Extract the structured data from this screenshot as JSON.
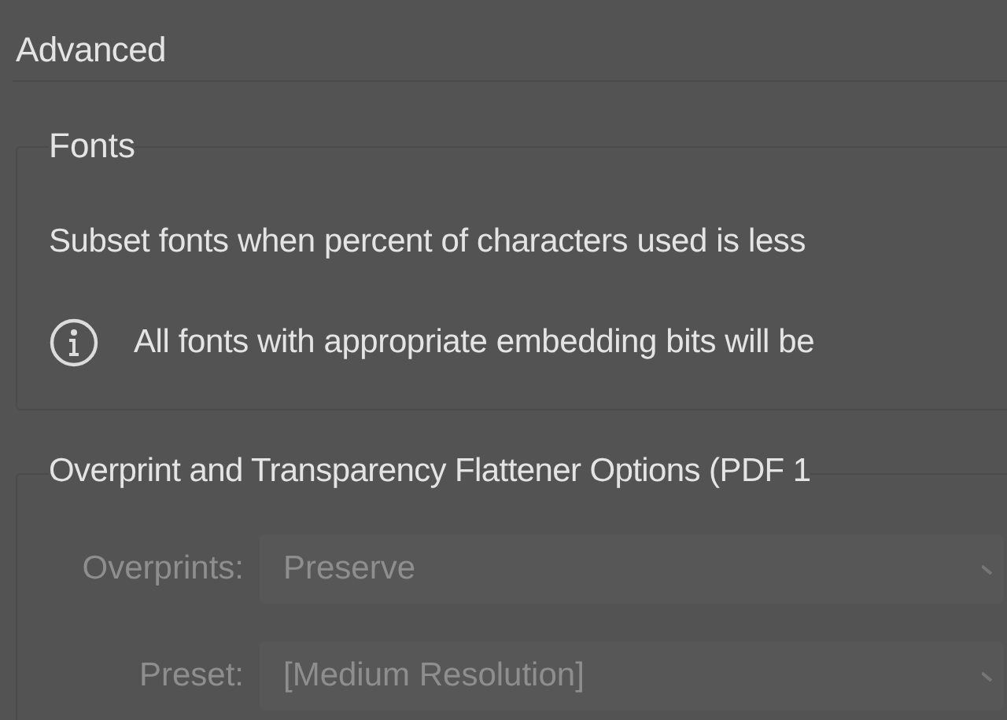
{
  "section_title": "Advanced",
  "fonts_group": {
    "title": "Fonts",
    "subset_text": "Subset fonts when percent of characters used is less",
    "info_text": "All fonts with appropriate embedding bits will be"
  },
  "overprint_group": {
    "title": "Overprint and Transparency Flattener Options (PDF 1",
    "fields": [
      {
        "label": "Overprints:",
        "value": "Preserve",
        "disabled": true
      },
      {
        "label": "Preset:",
        "value": "[Medium Resolution]",
        "disabled": true
      }
    ]
  }
}
